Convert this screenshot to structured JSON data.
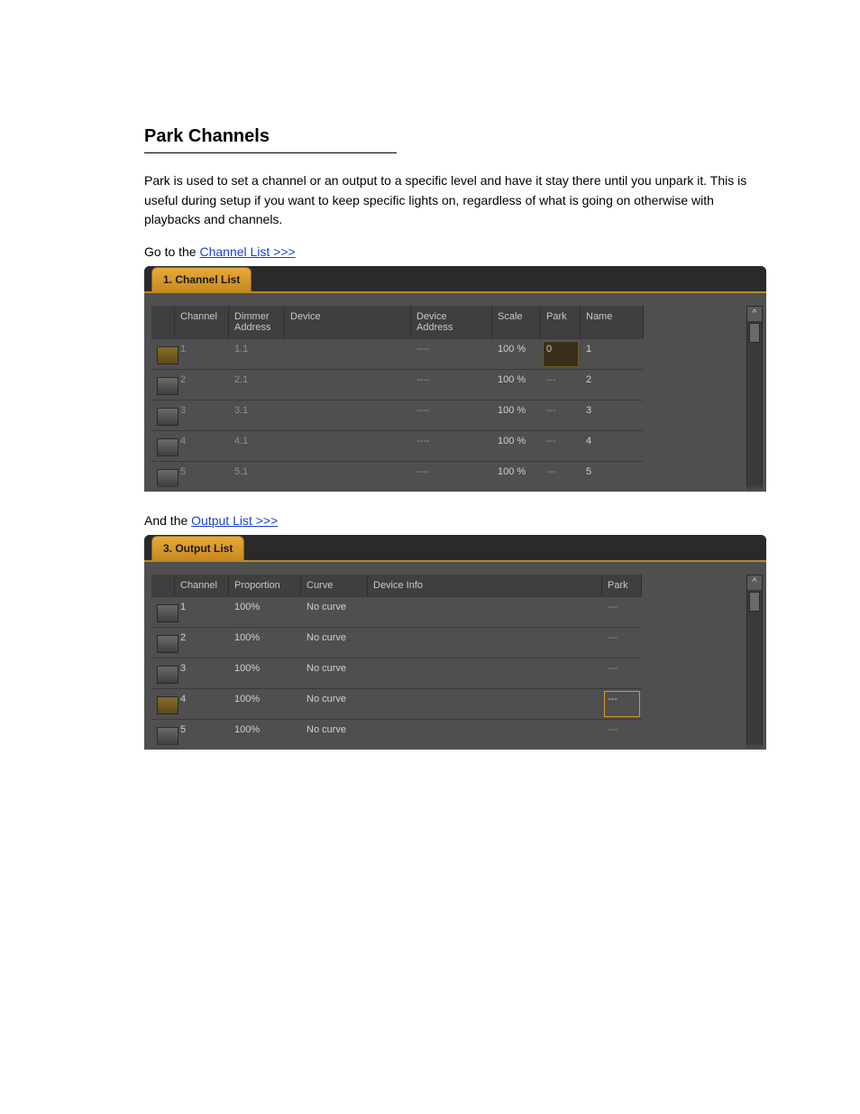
{
  "title": "Park Channels",
  "intro": "Park is used to set a channel or an output to a specific level and have it stay there until you unpark it. This is useful during setup if you want to keep specific lights on, regardless of what is going on otherwise with playbacks and channels.",
  "sections": [
    {
      "captionPrefix": "Go to the ",
      "captionLink": "Channel List >>>",
      "screenshot": {
        "tab": "1. Channel List",
        "headers": [
          "",
          "Channel",
          "Dimmer\nAddress",
          "Device",
          "Device\nAddress",
          "Scale",
          "Park",
          "Name"
        ],
        "rows": [
          {
            "sel": true,
            "ch": "1",
            "dim": "1.1",
            "dev": "",
            "addr": "----",
            "scale": "100 %",
            "park": "0",
            "name": "1",
            "park_boxed": true
          },
          {
            "sel": false,
            "ch": "2",
            "dim": "2.1",
            "dev": "",
            "addr": "----",
            "scale": "100 %",
            "park": "---",
            "name": "2"
          },
          {
            "sel": false,
            "ch": "3",
            "dim": "3.1",
            "dev": "",
            "addr": "----",
            "scale": "100 %",
            "park": "---",
            "name": "3"
          },
          {
            "sel": false,
            "ch": "4",
            "dim": "4.1",
            "dev": "",
            "addr": "----",
            "scale": "100 %",
            "park": "---",
            "name": "4"
          },
          {
            "sel": false,
            "ch": "5",
            "dim": "5.1",
            "dev": "",
            "addr": "----",
            "scale": "100 %",
            "park": "---",
            "name": "5"
          }
        ]
      }
    },
    {
      "captionPrefix": "And the ",
      "captionLink": "Output List >>>",
      "screenshot": {
        "tab": "3. Output List",
        "headers": [
          "",
          "Channel",
          "Proportion",
          "Curve",
          "Device Info",
          "Park"
        ],
        "rows": [
          {
            "sel": false,
            "ch": "1",
            "prop": "100%",
            "curve": "No curve",
            "info": "",
            "park": "---"
          },
          {
            "sel": false,
            "ch": "2",
            "prop": "100%",
            "curve": "No curve",
            "info": "",
            "park": "---"
          },
          {
            "sel": false,
            "ch": "3",
            "prop": "100%",
            "curve": "No curve",
            "info": "",
            "park": "---"
          },
          {
            "sel": true,
            "ch": "4",
            "prop": "100%",
            "curve": "No curve",
            "info": "",
            "park": "---",
            "park_boxed": true
          },
          {
            "sel": false,
            "ch": "5",
            "prop": "100%",
            "curve": "No curve",
            "info": "",
            "park": "---"
          }
        ]
      }
    }
  ],
  "scroll_up_glyph": "^"
}
